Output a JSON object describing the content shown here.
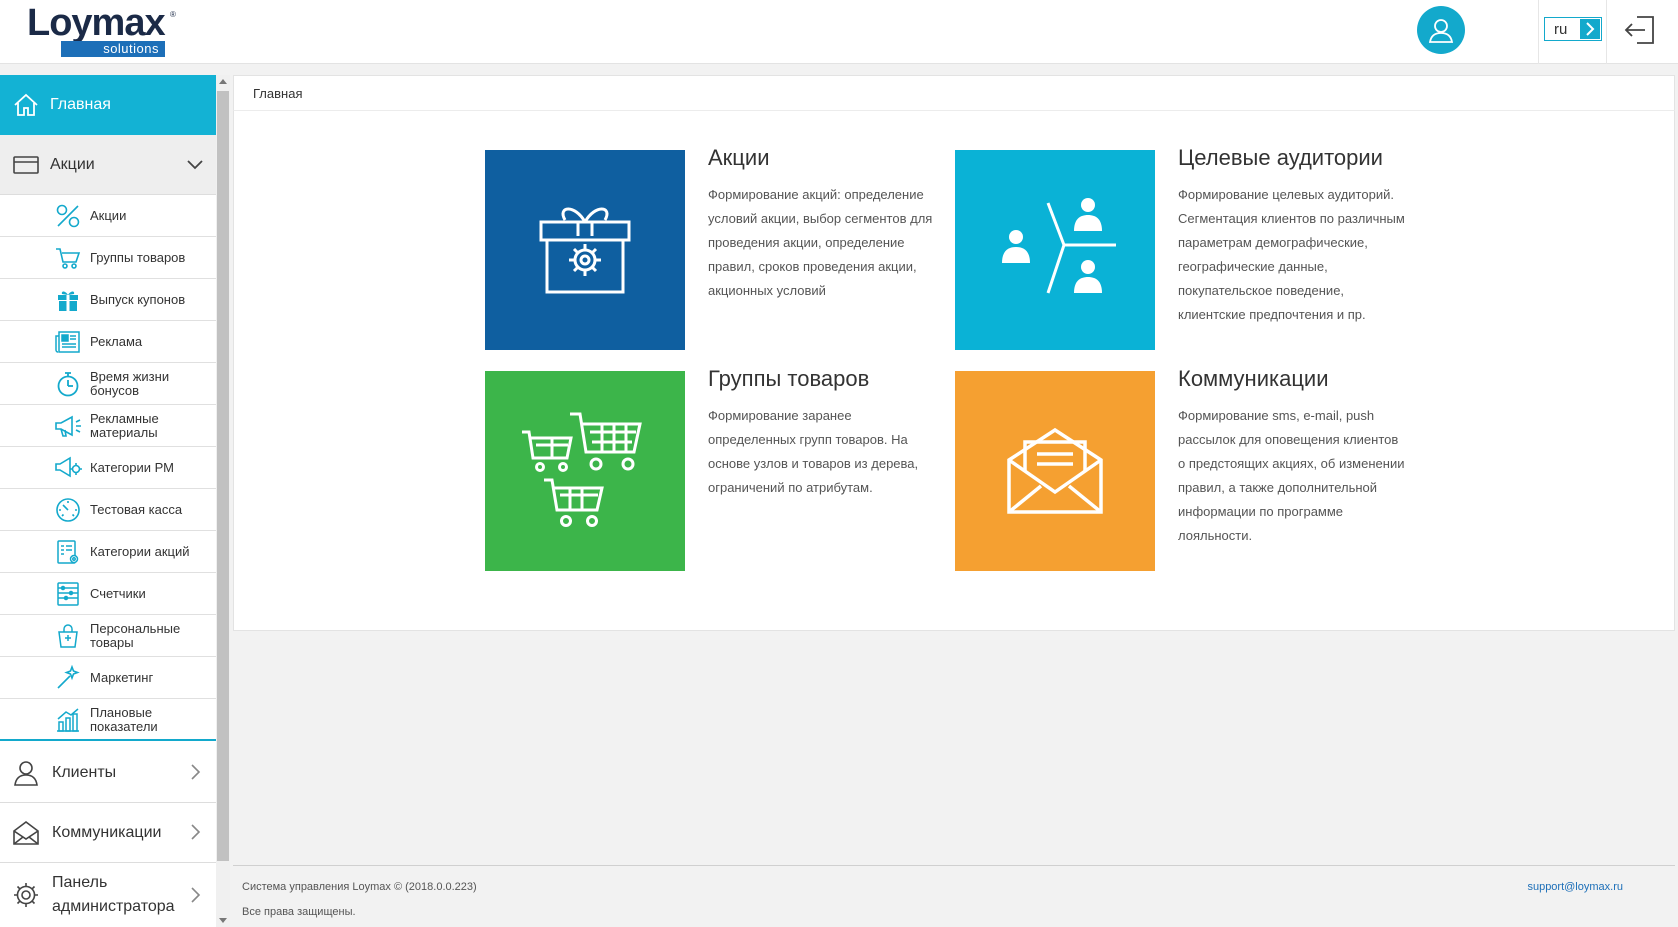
{
  "header": {
    "logo_word": "Loymax",
    "logo_tm": "®",
    "logo_sub": "solutions",
    "lang": "ru"
  },
  "colors": {
    "accent": "#13b2d4",
    "tile_blue": "#0f5fa0",
    "tile_cyan": "#0ab2d6",
    "tile_green": "#3cb54a",
    "tile_orange": "#f5a031"
  },
  "sidebar": {
    "home": "Главная",
    "akcii": "Акции",
    "sub_items": [
      {
        "label": "Акции",
        "icon": "percent-icon"
      },
      {
        "label": "Группы товаров",
        "icon": "cart-icon"
      },
      {
        "label": "Выпуск купонов",
        "icon": "gift-icon"
      },
      {
        "label": "Реклама",
        "icon": "newspaper-icon"
      },
      {
        "label": "Время жизни бонусов",
        "icon": "stopwatch-icon"
      },
      {
        "label": "Рекламные материалы",
        "icon": "megaphone-icon"
      },
      {
        "label": "Категории РМ",
        "icon": "megaphone-gear-icon"
      },
      {
        "label": "Тестовая касса",
        "icon": "gauge-icon"
      },
      {
        "label": "Категории акций",
        "icon": "list-gear-icon"
      },
      {
        "label": "Счетчики",
        "icon": "abacus-icon"
      },
      {
        "label": "Персональные товары",
        "icon": "bag-icon"
      },
      {
        "label": "Маркетинг",
        "icon": "wand-icon"
      },
      {
        "label": "Плановые показатели",
        "icon": "bar-chart-icon"
      }
    ],
    "clients": "Клиенты",
    "communications": "Коммуникации",
    "admin": "Панель администратора"
  },
  "breadcrumb": "Главная",
  "cards": [
    {
      "title": "Акции",
      "desc": "Формирование акций: определение условий акции, выбор сегментов для проведения акции, определение правил, сроков проведения акции, акционных условий"
    },
    {
      "title": "Целевые аудитории",
      "desc": "Формирование целевых аудиторий. Сегментация клиентов по различным параметрам демографические, географические данные, покупательское поведение, клиентские предпочтения и пр."
    },
    {
      "title": "Группы товаров",
      "desc": "Формирование заранее определенных групп товаров. На основе узлов и товаров из дерева, ограничений по атрибутам."
    },
    {
      "title": "Коммуникации",
      "desc": "Формирование sms, e-mail, push рассылок для оповещения клиентов о предстоящих акциях, об изменении правил, а также дополнительной информации по программе лояльности."
    }
  ],
  "footer": {
    "copyright": "Система управления Loymax © (2018.0.0.223)",
    "rights": "Все права защищены.",
    "support": "support@loymax.ru"
  }
}
